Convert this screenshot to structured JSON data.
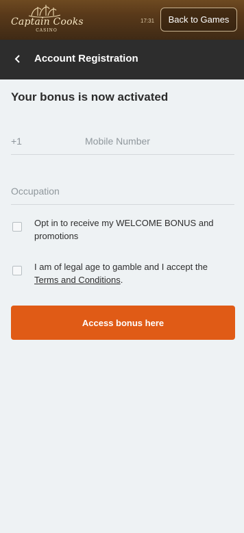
{
  "topbar": {
    "logo_text": "Captain Cooks",
    "logo_sub": "CASINO",
    "clock": "17:31",
    "back_button_label": "Back to Games"
  },
  "header": {
    "back_icon": "chevron-left",
    "title": "Account Registration"
  },
  "form": {
    "bonus_title": "Your bonus is now activated",
    "mobile": {
      "prefix": "+1",
      "placeholder": "Mobile Number",
      "value": ""
    },
    "occupation": {
      "placeholder": "Occupation",
      "value": ""
    },
    "opt_in": {
      "checked": false,
      "text": "Opt in to receive my WELCOME BONUS and promotions"
    },
    "legal": {
      "checked": false,
      "text_before": "I am of legal age to gamble and I accept the ",
      "link_text": "Terms and Conditions",
      "text_after": "."
    },
    "submit_label": "Access bonus here"
  },
  "colors": {
    "topbar": "#5a3a1a",
    "header": "#2d2d2d",
    "page_background": "#eef2f4",
    "accent": "#e05b16",
    "text": "#2f2f2f",
    "placeholder": "#8f979c"
  }
}
